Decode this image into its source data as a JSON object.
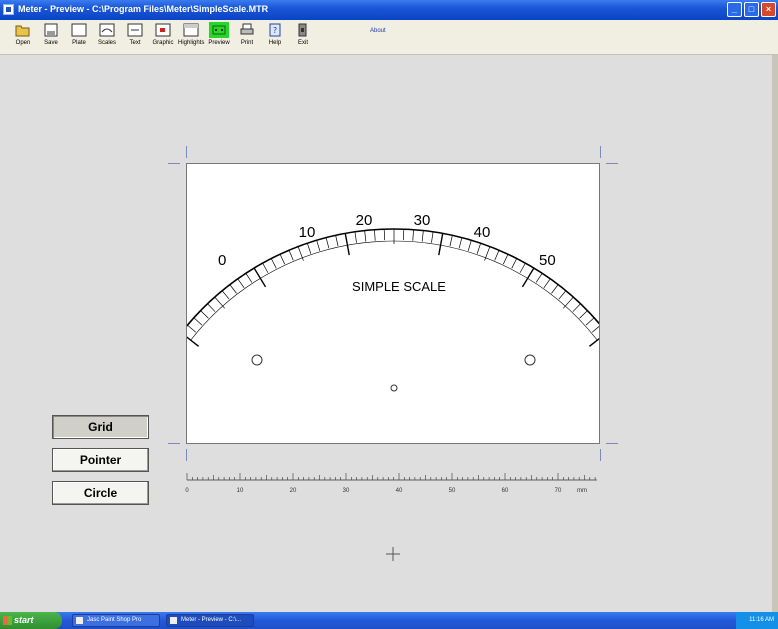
{
  "window": {
    "title": "Meter - Preview - C:\\Program Files\\Meter\\SimpleScale.MTR",
    "controls": [
      "_",
      "□",
      "×"
    ]
  },
  "toolbar": {
    "tools": [
      {
        "label": "Open",
        "icon": "folder-open-icon"
      },
      {
        "label": "Save",
        "icon": "save-icon"
      },
      {
        "label": "Plate",
        "icon": "plate-icon"
      },
      {
        "label": "Scales",
        "icon": "scales-icon"
      },
      {
        "label": "Text",
        "icon": "text-icon"
      },
      {
        "label": "Graphic",
        "icon": "graphic-icon"
      },
      {
        "label": "Highlights",
        "icon": "highlights-icon"
      },
      {
        "label": "Preview",
        "icon": "preview-icon",
        "active": true
      },
      {
        "label": "Print",
        "icon": "printer-icon"
      },
      {
        "label": "Help",
        "icon": "help-icon"
      },
      {
        "label": "Exit",
        "icon": "exit-icon"
      }
    ],
    "about_label": "About"
  },
  "dial": {
    "scale_labels": [
      "0",
      "10",
      "20",
      "30",
      "40",
      "50"
    ],
    "caption": "SIMPLE SCALE"
  },
  "ruler": {
    "labels": [
      "0",
      "10",
      "20",
      "30",
      "40",
      "50",
      "60",
      "70"
    ],
    "unit": "mm"
  },
  "side_buttons": {
    "grid": "Grid",
    "pointer": "Pointer",
    "circle": "Circle"
  },
  "taskbar": {
    "start_label": "start",
    "items": [
      {
        "label": "Jasc Paint Shop Pro"
      },
      {
        "label": "Meter - Preview - C:\\..."
      }
    ],
    "clock": "11:16 AM"
  },
  "colors": {
    "preview_active": "#2bd42b",
    "workspace": "#dedede",
    "titlebar": "#1a56d6"
  }
}
